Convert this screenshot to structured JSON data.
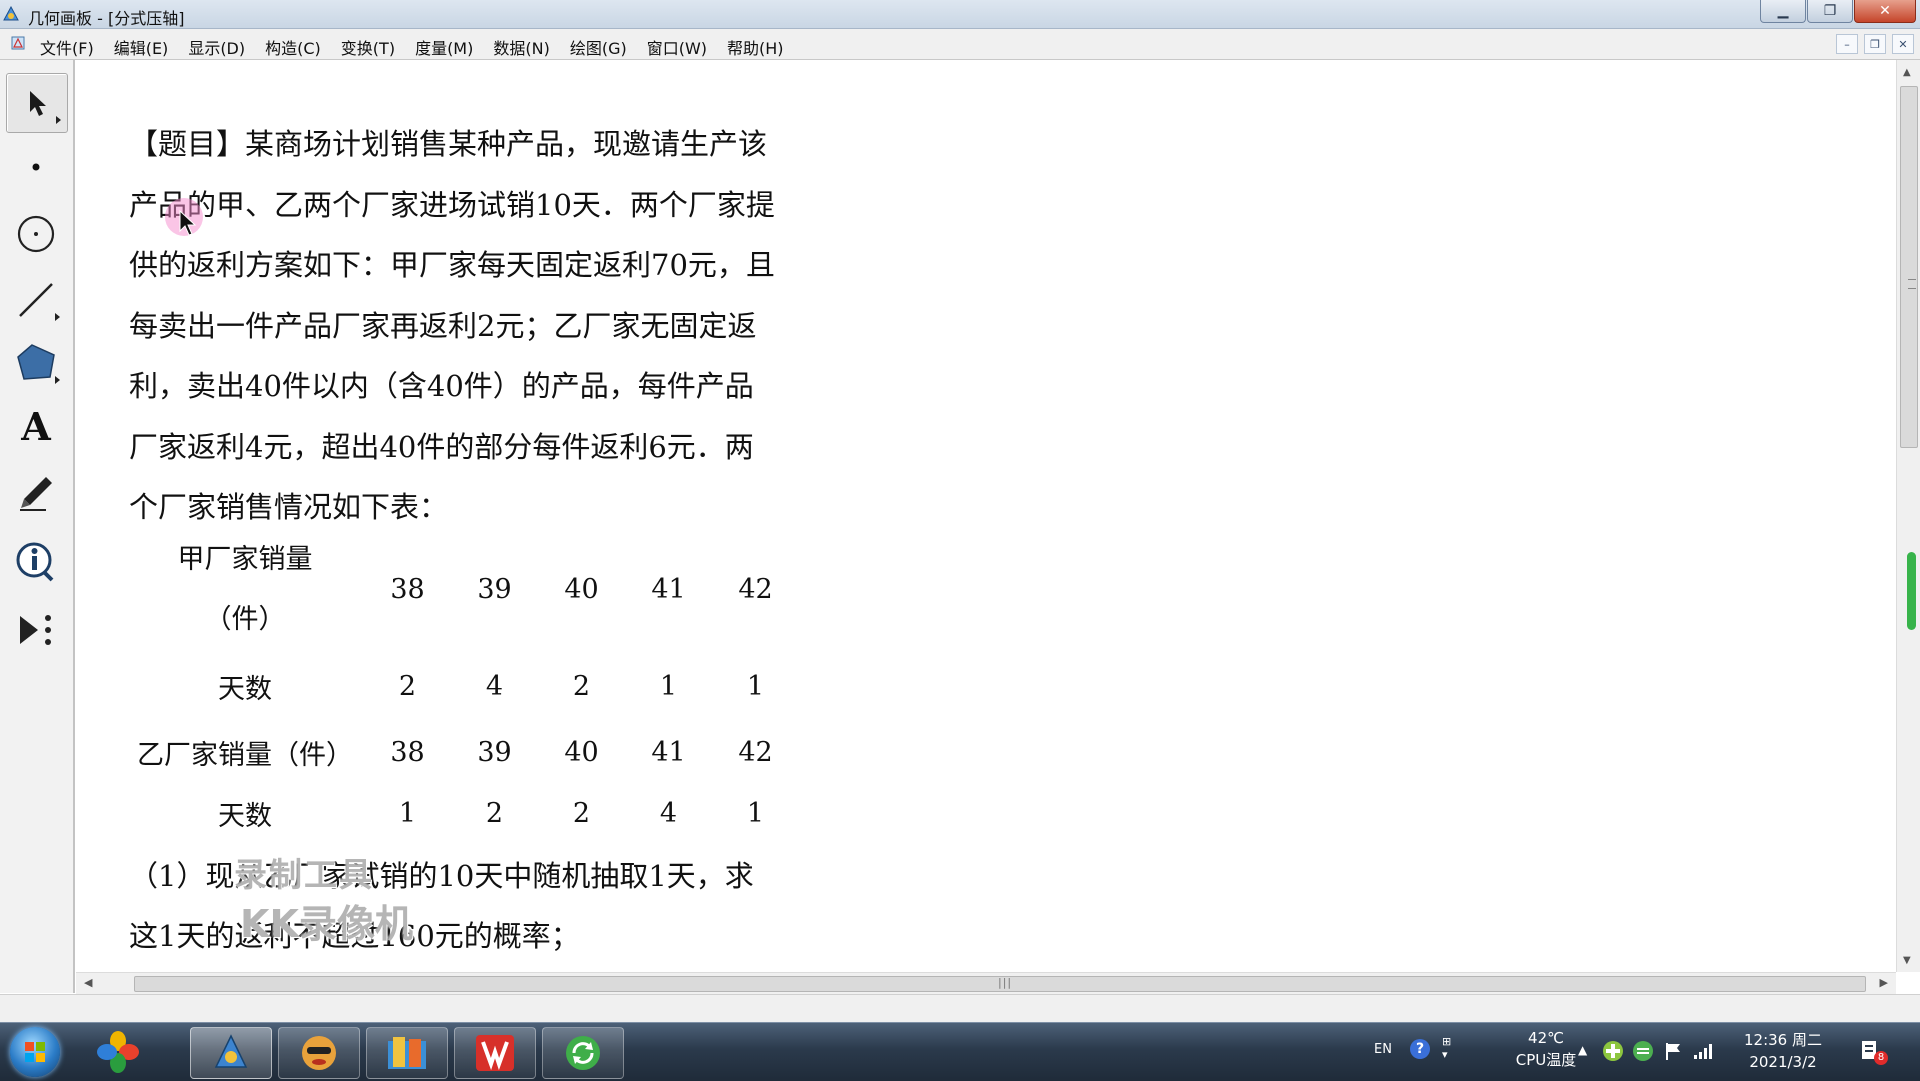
{
  "window": {
    "title": "几何画板 - [分式压轴]"
  },
  "menu": {
    "items": [
      "文件(F)",
      "编辑(E)",
      "显示(D)",
      "构造(C)",
      "变换(T)",
      "度量(M)",
      "数据(N)",
      "绘图(G)",
      "窗口(W)",
      "帮助(H)"
    ]
  },
  "toolbar": {
    "tools": [
      "selection-arrow-tool",
      "point-tool",
      "compass-tool",
      "straightedge-tool",
      "polygon-tool",
      "text-tool",
      "marker-tool",
      "information-tool",
      "custom-tool"
    ],
    "text_tool_glyph": "A"
  },
  "problem": {
    "lines": [
      "【题目】某商场计划销售某种产品，现邀请生产该",
      "产品的甲、乙两个厂家进场试销10天．两个厂家提",
      "供的返利方案如下：甲厂家每天固定返利70元，且",
      "每卖出一件产品厂家再返利2元；乙厂家无固定返",
      "利，卖出40件以内（含40件）的产品，每件产品",
      "厂家返利4元，超出40件的部分每件返利6元．两",
      "个厂家销售情况如下表："
    ]
  },
  "table": {
    "rows": [
      {
        "header_lines": [
          "甲厂家销量",
          "（件）"
        ],
        "values": [
          "38",
          "39",
          "40",
          "41",
          "42"
        ]
      },
      {
        "header_lines": [
          "天数"
        ],
        "values": [
          "2",
          "4",
          "2",
          "1",
          "1"
        ]
      },
      {
        "header_lines": [
          "乙厂家销量（件）"
        ],
        "values": [
          "38",
          "39",
          "40",
          "41",
          "42"
        ]
      },
      {
        "header_lines": [
          "天数"
        ],
        "values": [
          "1",
          "2",
          "2",
          "4",
          "1"
        ]
      }
    ]
  },
  "question": {
    "lines": [
      "（1）现从乙厂家试销的10天中随机抽取1天，求",
      "这1天的返利不超过160元的概率；"
    ]
  },
  "watermark": {
    "line1": "录制工具",
    "line2": "KK录像机"
  },
  "taskbar": {
    "apps": [
      "start-button",
      "app-colorful-petals",
      "geometer-sketchpad",
      "app-mascot",
      "file-manager",
      "wps-presentation",
      "sync-app"
    ]
  },
  "tray": {
    "language": "EN",
    "help": "?",
    "temperature": "42℃",
    "temperature_label": "CPU温度",
    "time": "12:36 周二",
    "date": "2021/3/2",
    "notification_count": "8"
  },
  "colors": {
    "taskbar": "#2b3a4c",
    "green_indicator": "#37b34a",
    "cursor_highlight": "#f58ccd"
  }
}
